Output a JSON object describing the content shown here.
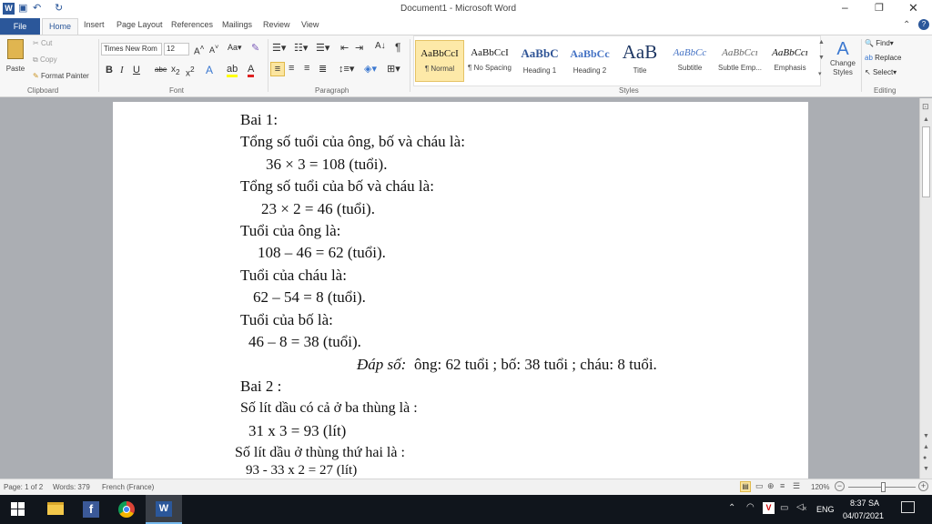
{
  "window": {
    "title": "Document1 - Microsoft Word"
  },
  "tabs": {
    "file": "File",
    "home": "Home",
    "insert": "Insert",
    "page_layout": "Page Layout",
    "references": "References",
    "mailings": "Mailings",
    "review": "Review",
    "view": "View"
  },
  "clipboard": {
    "paste": "Paste",
    "cut": "Cut",
    "copy": "Copy",
    "format_painter": "Format Painter",
    "label": "Clipboard"
  },
  "font": {
    "name": "Times New Rom",
    "size": "12",
    "label": "Font"
  },
  "paragraph": {
    "label": "Paragraph"
  },
  "styles": {
    "label": "Styles",
    "items": [
      {
        "preview": "AaBbCcI",
        "name": "¶ Normal"
      },
      {
        "preview": "AaBbCcI",
        "name": "¶ No Spacing"
      },
      {
        "preview": "AaBbC",
        "name": "Heading 1"
      },
      {
        "preview": "AaBbCc",
        "name": "Heading 2"
      },
      {
        "preview": "AaB",
        "name": "Title"
      },
      {
        "preview": "AaBbCc",
        "name": "Subtitle"
      },
      {
        "preview": "AaBbCcı",
        "name": "Subtle Emp..."
      },
      {
        "preview": "AaBbCcı",
        "name": "Emphasis"
      }
    ],
    "change_styles": "Change Styles"
  },
  "editing": {
    "find": "Find",
    "replace": "Replace",
    "select": "Select",
    "label": "Editing"
  },
  "document": {
    "lines": [
      "Bai 1:",
      "Tổng số tuổi của ông, bố và cháu là:",
      "36 × 3 = 108 (tuổi).",
      "Tổng số tuổi của bố và cháu là:",
      "23 × 2 = 46 (tuổi).",
      "Tuổi của ông là:",
      "108 – 46 = 62 (tuổi).",
      "Tuổi của cháu là:",
      "62 – 54 = 8 (tuổi).",
      "Tuổi của bố là:",
      "46 – 8 = 38 (tuổi).",
      "ông: 62 tuổi ; bố: 38 tuổi ; cháu: 8 tuổi.",
      "Bai 2 :",
      "Số lít dầu  có cả ở ba thùng là :",
      "31 x 3 = 93 (lít)",
      "Số lít dầu ở thùng thứ hai là :",
      "93 - 33 x 2 = 27 (lít)"
    ],
    "answer_label": "Đáp số:"
  },
  "status": {
    "page": "Page: 1 of 2",
    "words": "Words: 379",
    "language": "French (France)",
    "zoom": "120%"
  },
  "taskbar": {
    "lang": "ENG",
    "time": "8:37 SA",
    "date": "04/07/2021"
  },
  "colors": {
    "accent": "#2b579a",
    "taskbar": "#10151c"
  }
}
